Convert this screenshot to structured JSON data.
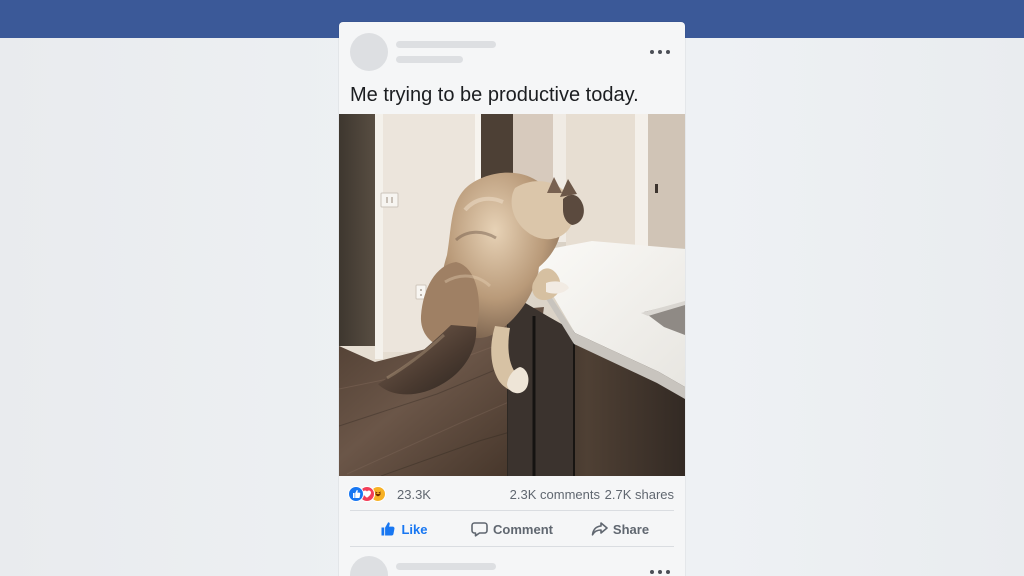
{
  "post": {
    "caption": "Me trying to be productive today.",
    "media": {
      "description": "Cat on hind legs at kitchen counter"
    }
  },
  "stats": {
    "reaction_icons": [
      "like-icon",
      "love-icon",
      "haha-icon"
    ],
    "reactions": "23.3K",
    "comments": "2.3K comments",
    "shares": "2.7K shares"
  },
  "actions": {
    "like": "Like",
    "comment": "Comment",
    "share": "Share"
  },
  "colors": {
    "topbar": "#3b5998",
    "card": "#f5f6f7",
    "accent": "#1877f2",
    "love": "#f33e58",
    "haha": "#f7b125"
  }
}
